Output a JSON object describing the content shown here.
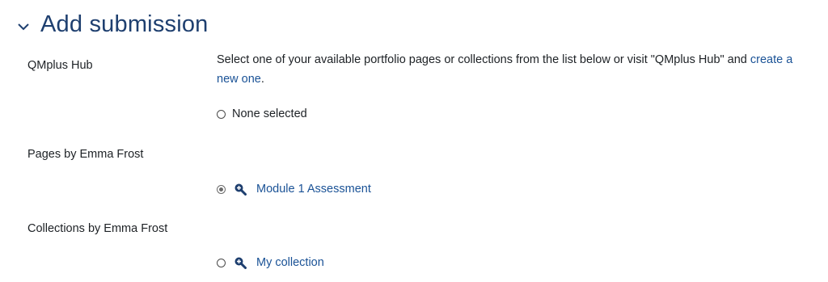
{
  "section": {
    "title": "Add submission",
    "chevron_icon": "chevron-down-icon"
  },
  "hub": {
    "label": "QMplus Hub",
    "description_prefix": "Select one of your available portfolio pages or collections from the list below or visit \"QMplus Hub\" and ",
    "create_link": "create a new one",
    "description_suffix": ".",
    "none_option": "None selected"
  },
  "pages": {
    "label": "Pages by Emma Frost",
    "items": [
      {
        "label": "Module 1 Assessment",
        "selected": true,
        "icon": "zoom-in-icon"
      }
    ]
  },
  "collections": {
    "label": "Collections by Emma Frost",
    "items": [
      {
        "label": "My collection",
        "selected": false,
        "icon": "zoom-in-icon"
      }
    ]
  },
  "colors": {
    "title": "#1e3f6f",
    "link": "#1a5296",
    "text": "#1d2125"
  }
}
